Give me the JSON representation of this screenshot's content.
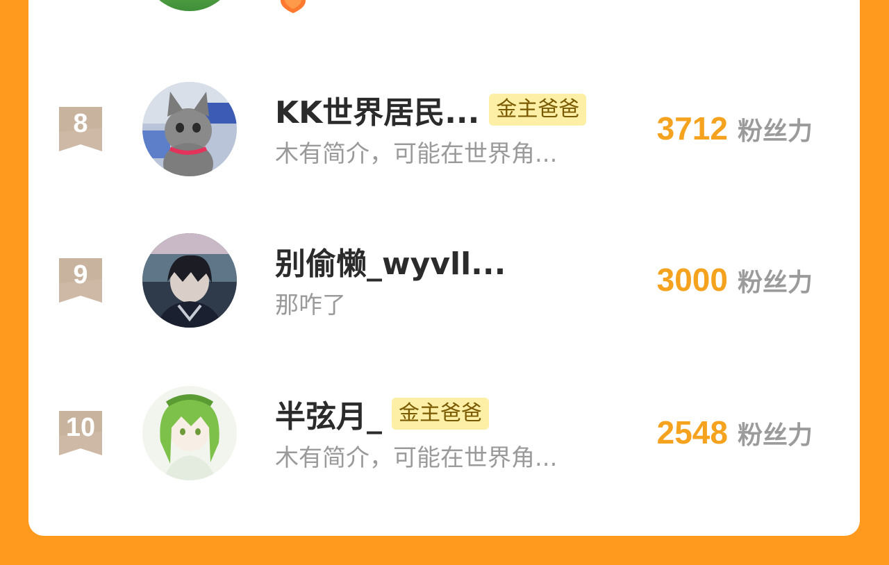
{
  "colors": {
    "page_background": "#ff9a1f",
    "card_background": "#ffffff",
    "fans_number": "#f5a21f",
    "tag_background": "#fdf0a6",
    "rank_badge": "#cdb9a5"
  },
  "leaderboard": {
    "rows": [
      {
        "rank": "8",
        "name": "KK世界居民...",
        "tag": "金主爸爸",
        "bio": "木有简介，可能在世界角...",
        "fans_value": "3712",
        "fans_label": "粉丝力",
        "avatar_icon": "kitten-avatar"
      },
      {
        "rank": "9",
        "name": "别偷懒_wyvll...",
        "tag": "",
        "bio": "那咋了",
        "fans_value": "3000",
        "fans_label": "粉丝力",
        "avatar_icon": "anime-boy-avatar"
      },
      {
        "rank": "10",
        "name": "半弦月_",
        "tag": "金主爸爸",
        "bio": "木有简介，可能在世界角...",
        "fans_value": "2548",
        "fans_label": "粉丝力",
        "avatar_icon": "green-hair-avatar"
      }
    ]
  }
}
